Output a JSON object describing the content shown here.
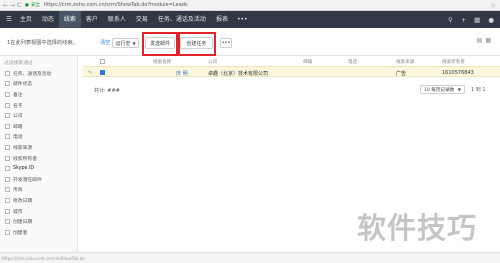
{
  "browser": {
    "secure_label": "安全",
    "url": "https://crm.zoho.com.cn/crm/ShowTab.do?module=Leads"
  },
  "nav": {
    "items": [
      "主页",
      "动态",
      "线索",
      "客户",
      "联系人",
      "交易",
      "任务、通话及活动",
      "报表"
    ],
    "active": "线索"
  },
  "toolbar": {
    "hint": "1在此列表视图中选择的线索。",
    "clear_link": "清空",
    "followup_btn": "运行宏",
    "send_email_btn": "发送邮件",
    "create_task_btn": "创建任务",
    "more_btn": "•••"
  },
  "sidebar": {
    "title": "过滤线索通过",
    "items": [
      "任务、通话及活动",
      "邮件状态",
      "备注",
      "名字",
      "公司",
      "邮箱",
      "电话",
      "线索来源",
      "线索所有者",
      "Skype ID",
      "开发潜在邮件",
      "传真",
      "修改日期",
      "城市",
      "创建日期",
      "创建者"
    ]
  },
  "table": {
    "columns": [
      "线索名称",
      "公司",
      "邮箱",
      "电话",
      "线索来源",
      "线索所有者"
    ],
    "rows": [
      {
        "name": "庆 明",
        "company": "卓趣（北京）技术有限公司",
        "email": "",
        "phone": "",
        "source": "广告",
        "owner": "1610576843"
      }
    ]
  },
  "footer": {
    "total_label": "共计: ###",
    "per_page": "10 每页记录数",
    "pager": "1 到 1"
  },
  "watermark": "软件技巧",
  "status": {
    "text": "https://crm.zoho.com.cn/crm/ShowTab.do"
  }
}
